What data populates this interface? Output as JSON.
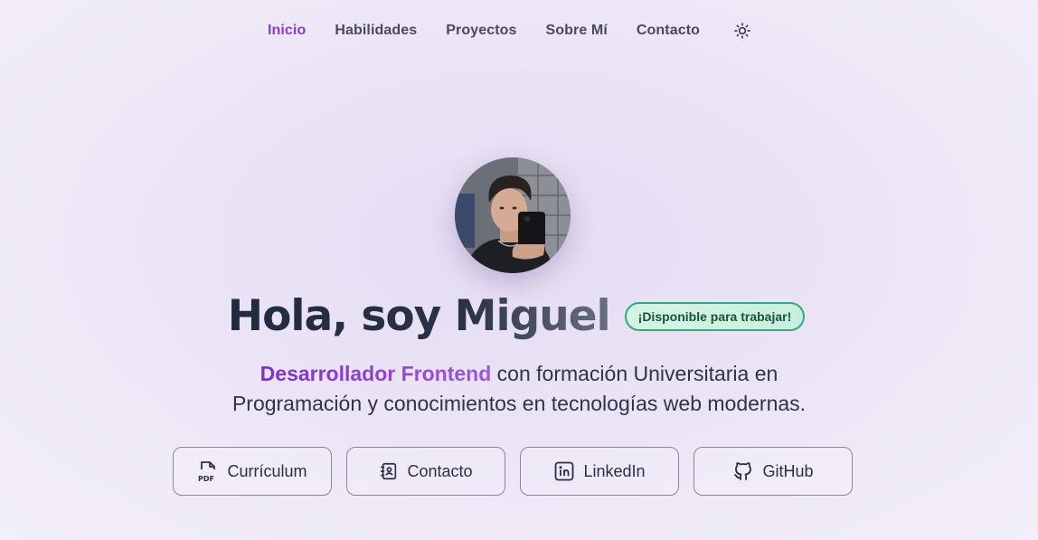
{
  "nav": {
    "items": [
      {
        "label": "Inicio",
        "active": true
      },
      {
        "label": "Habilidades",
        "active": false
      },
      {
        "label": "Proyectos",
        "active": false
      },
      {
        "label": "Sobre Mí",
        "active": false
      },
      {
        "label": "Contacto",
        "active": false
      }
    ],
    "theme_toggle_icon": "sun-icon"
  },
  "hero": {
    "avatar_icon": "profile-photo",
    "title": "Hola, soy Miguel",
    "badge": "¡Disponible para trabajar!",
    "role": "Desarrollador Frontend",
    "line1_rest": " con formación Universitaria en",
    "line2": "Programación y conocimientos en tecnologías web modernas."
  },
  "buttons": [
    {
      "label": "Currículum",
      "icon": "pdf-icon"
    },
    {
      "label": "Contacto",
      "icon": "contact-book-icon"
    },
    {
      "label": "LinkedIn",
      "icon": "linkedin-icon"
    },
    {
      "label": "GitHub",
      "icon": "github-icon"
    }
  ],
  "colors": {
    "accent": "#8a3ad8",
    "badge_border": "#3aa57f",
    "badge_bg": "#d4f4e4"
  }
}
